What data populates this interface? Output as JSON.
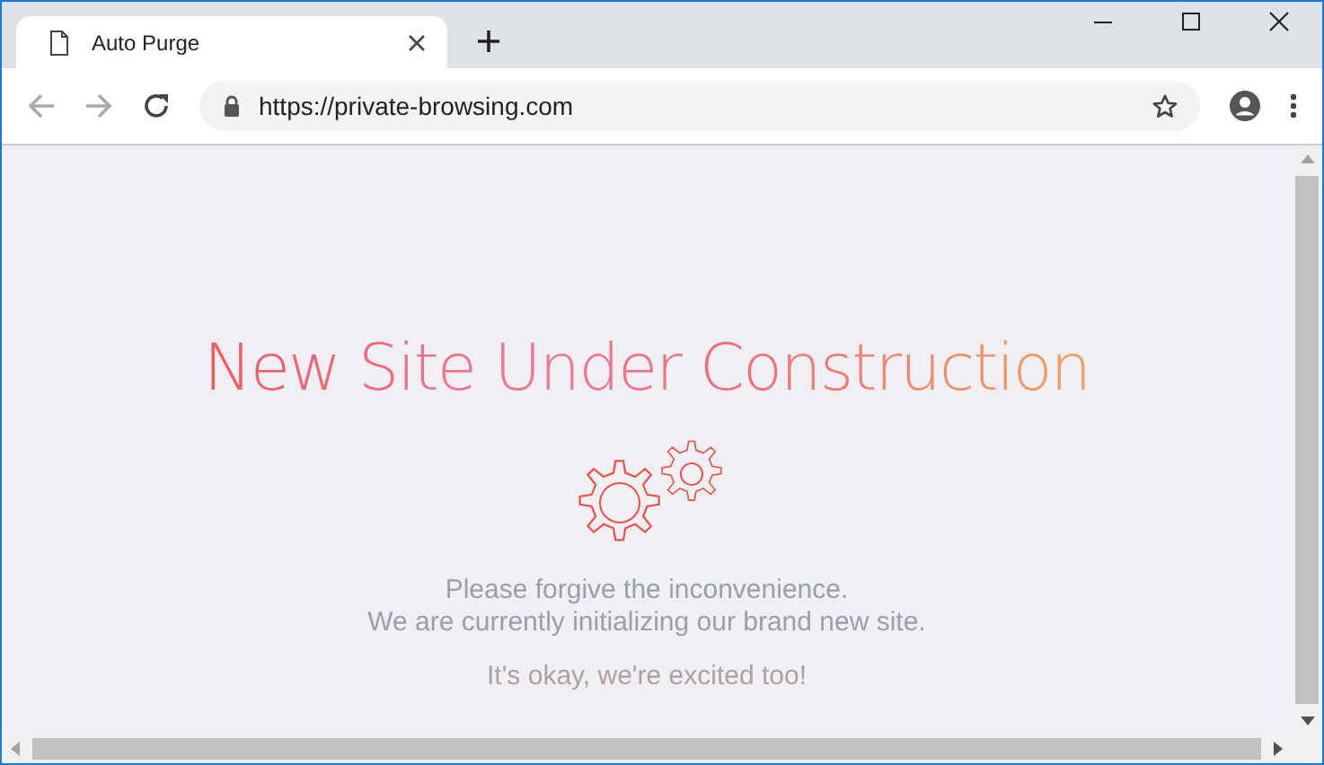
{
  "tabs": [
    {
      "title": "Auto Purge",
      "selected": true
    }
  ],
  "address_bar": {
    "url": "https://private-browsing.com"
  },
  "page": {
    "heading": "New Site Under Construction",
    "message_lines": [
      "Please forgive the inconvenience.",
      "We are currently initializing our brand new site."
    ],
    "footer_line": "It's okay, we're excited too!"
  }
}
